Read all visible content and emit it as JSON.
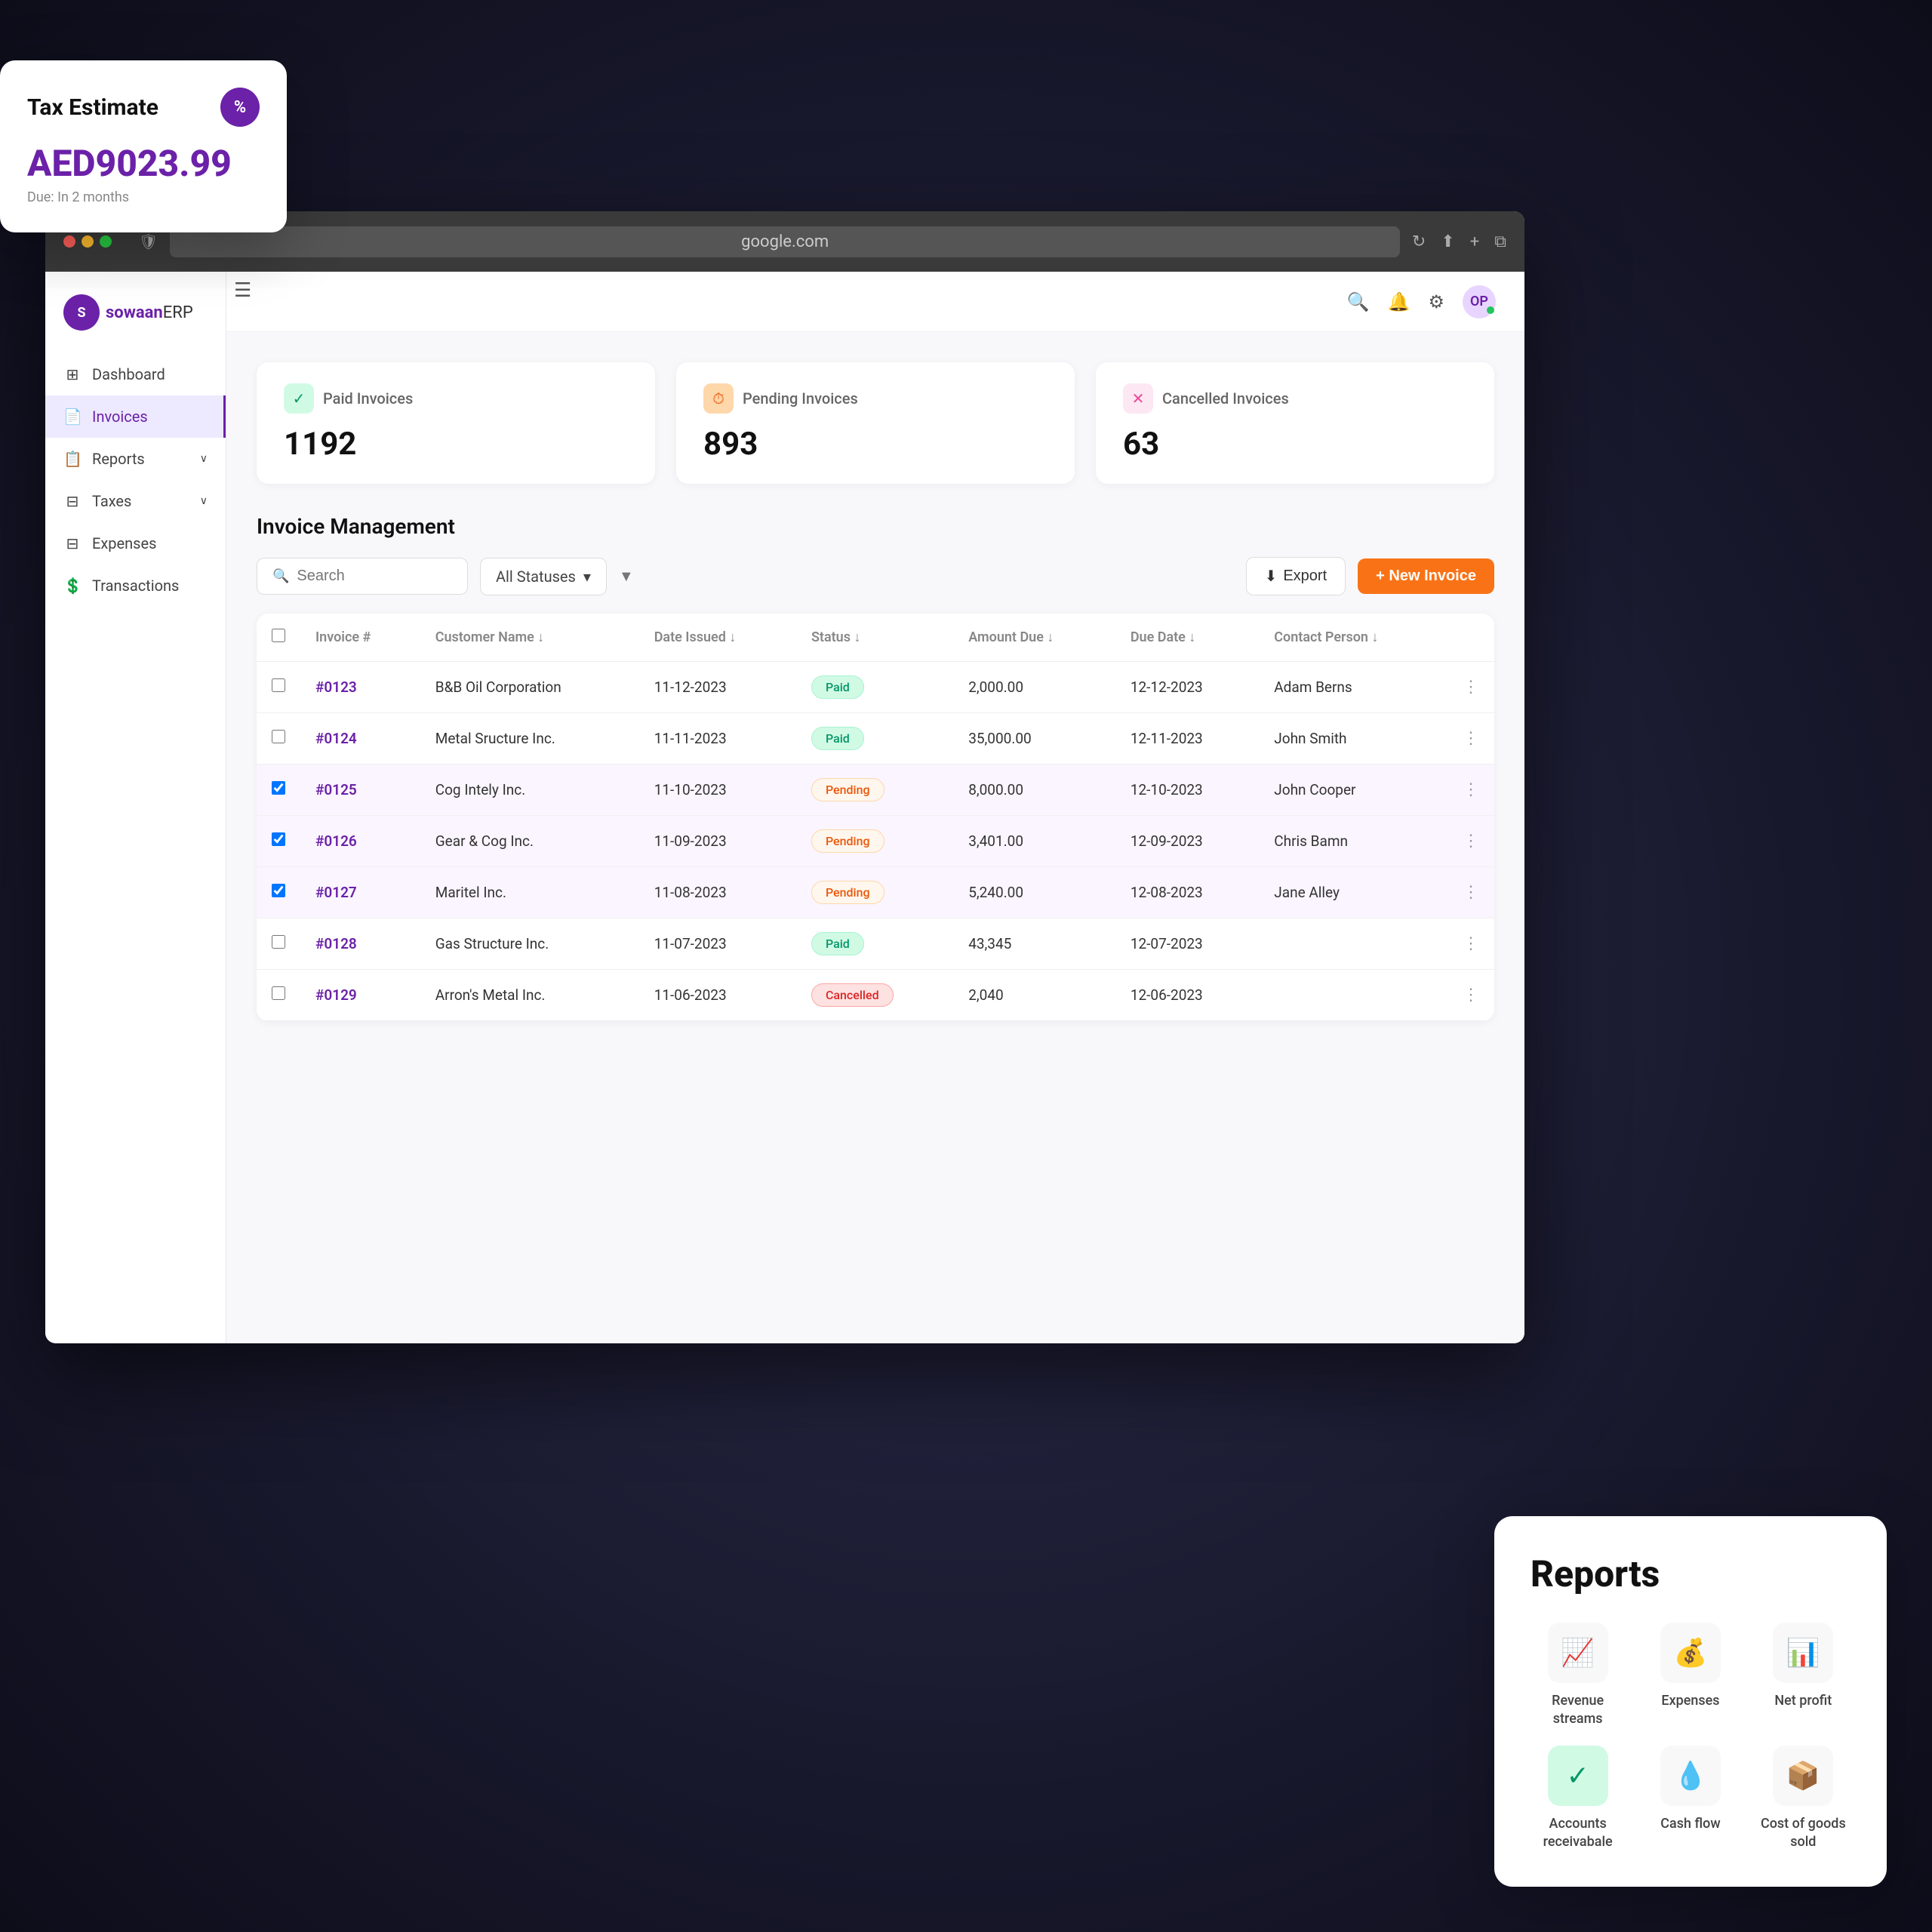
{
  "browser": {
    "url": "google.com"
  },
  "app": {
    "logo_text": "sowaan",
    "logo_suffix": "ERP"
  },
  "sidebar": {
    "items": [
      {
        "label": "Dashboard",
        "icon": "⊞",
        "active": false
      },
      {
        "label": "Invoices",
        "icon": "📄",
        "active": true
      },
      {
        "label": "Reports",
        "icon": "📋",
        "active": false,
        "has_arrow": true
      },
      {
        "label": "Taxes",
        "icon": "⊟",
        "active": false,
        "has_arrow": true
      },
      {
        "label": "Expenses",
        "icon": "⊟",
        "active": false
      },
      {
        "label": "Transactions",
        "icon": "💲",
        "active": false
      }
    ]
  },
  "summary_cards": [
    {
      "label": "Paid Invoices",
      "value": "1192",
      "icon_type": "green",
      "icon": "✓"
    },
    {
      "label": "Pending Invoices",
      "value": "893",
      "icon_type": "orange",
      "icon": "⏱"
    },
    {
      "label": "Cancelled Invoices",
      "value": "63",
      "icon_type": "pink",
      "icon": "✕"
    }
  ],
  "invoice_management": {
    "title": "Invoice Management",
    "search_placeholder": "Search",
    "filter_label": "All Statuses",
    "export_label": "Export",
    "new_invoice_label": "+ New Invoice"
  },
  "table": {
    "columns": [
      "Invoice #",
      "Customer Name",
      "Date Issued",
      "Status",
      "Amount Due",
      "Due Date",
      "Contact Person"
    ],
    "rows": [
      {
        "id": "#0123",
        "customer": "B&B Oil Corporation",
        "date_issued": "11-12-2023",
        "status": "Paid",
        "amount": "2,000.00",
        "due_date": "12-12-2023",
        "contact": "Adam Berns"
      },
      {
        "id": "#0124",
        "customer": "Metal Sructure Inc.",
        "date_issued": "11-11-2023",
        "status": "Paid",
        "amount": "35,000.00",
        "due_date": "12-11-2023",
        "contact": "John Smith"
      },
      {
        "id": "#0125",
        "customer": "Cog Intely Inc.",
        "date_issued": "11-10-2023",
        "status": "Pending",
        "amount": "8,000.00",
        "due_date": "12-10-2023",
        "contact": "John Cooper",
        "selected": true
      },
      {
        "id": "#0126",
        "customer": "Gear & Cog Inc.",
        "date_issued": "11-09-2023",
        "status": "Pending",
        "amount": "3,401.00",
        "due_date": "12-09-2023",
        "contact": "Chris Bamn",
        "selected": true
      },
      {
        "id": "#0127",
        "customer": "Maritel Inc.",
        "date_issued": "11-08-2023",
        "status": "Pending",
        "amount": "5,240.00",
        "due_date": "12-08-2023",
        "contact": "Jane Alley",
        "selected": true
      },
      {
        "id": "#0128",
        "customer": "Gas Structure Inc.",
        "date_issued": "11-07-2023",
        "status": "Paid",
        "amount": "43,345",
        "due_date": "12-07-2023",
        "contact": ""
      },
      {
        "id": "#0129",
        "customer": "Arron's Metal Inc.",
        "date_issued": "11-06-2023",
        "status": "Cancelled",
        "amount": "2,040",
        "due_date": "12-06-2023",
        "contact": ""
      }
    ]
  },
  "tax_estimate": {
    "title": "Tax Estimate",
    "amount": "AED9023.99",
    "due_text": "Due: In 2 months",
    "icon": "%"
  },
  "reports": {
    "title": "Reports",
    "items": [
      {
        "label": "Revenue streams",
        "icon": "📈",
        "type": "icon"
      },
      {
        "label": "Expenses",
        "icon": "💰",
        "type": "icon"
      },
      {
        "label": "Net profit",
        "icon": "📊",
        "type": "icon"
      },
      {
        "label": "Accounts receivabale",
        "icon": "✓",
        "type": "check"
      },
      {
        "label": "Cash flow",
        "icon": "🚿",
        "type": "icon"
      },
      {
        "label": "Cost of goods sold",
        "icon": "📦",
        "type": "icon"
      }
    ]
  }
}
